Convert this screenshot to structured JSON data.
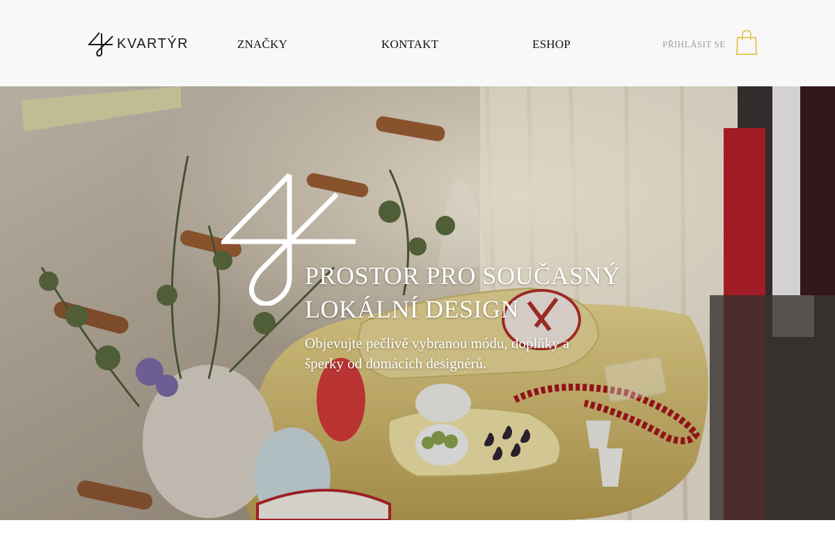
{
  "brand": {
    "name": "KVARTÝR"
  },
  "nav": {
    "items": [
      {
        "label": "ZNAČKY"
      },
      {
        "label": "KONTAKT"
      },
      {
        "label": "ESHOP"
      }
    ],
    "login_label": "PŘIHLÁSIT SE"
  },
  "cart": {
    "icon": "shopping-bag-icon",
    "color": "#e0c44a"
  },
  "hero": {
    "title_line1": "PROSTOR PRO SOUČASNÝ",
    "title_line2": "LOKÁLNÍ DESIGN",
    "subtitle": "Objevujte pečlivě vybranou módu, doplňky a šperky od domácích designérů.",
    "image": "store interior photo"
  },
  "colors": {
    "header_bg": "#f8f8f8",
    "text": "#111111",
    "login": "#9a9a9a",
    "hero_text": "#ffffff"
  }
}
